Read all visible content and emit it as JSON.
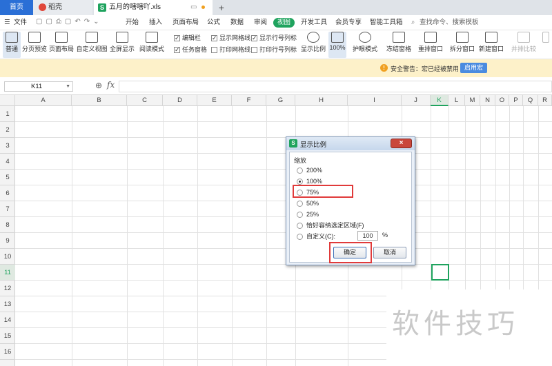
{
  "tabs": {
    "home": "首页",
    "daoke": "稻壳",
    "doc": "五月的嗐嗐吖.xls",
    "new_tab": "+"
  },
  "menu": {
    "file": "文件",
    "items": [
      "开始",
      "插入",
      "页面布局",
      "公式",
      "数据",
      "审阅",
      "视图",
      "开发工具",
      "会员专享",
      "智能工具箱"
    ],
    "search": "查找命令、搜索模板"
  },
  "ribbon": {
    "buttons": [
      "普通",
      "分页预览",
      "页面布局",
      "自定义视图",
      "全屏显示",
      "阅读模式",
      "显示比例",
      "100%",
      "护眼模式",
      "冻结窗格",
      "重排窗口",
      "拆分窗口",
      "新建窗口",
      "并排比较"
    ],
    "checks": [
      {
        "label": "编辑栏",
        "checked": true
      },
      {
        "label": "显示网格线",
        "checked": true
      },
      {
        "label": "显示行号列标",
        "checked": true
      },
      {
        "label": "任务窗格",
        "checked": true
      },
      {
        "label": "打印网格线",
        "checked": false
      },
      {
        "label": "打印行号列标",
        "checked": false
      }
    ]
  },
  "security": {
    "text": "安全警告：宏已经被禁用",
    "button": "启用宏"
  },
  "formula_bar": {
    "cell_ref": "K11",
    "fx": "fx"
  },
  "columns": [
    "A",
    "B",
    "C",
    "D",
    "E",
    "F",
    "G",
    "H",
    "I",
    "J",
    "K",
    "L",
    "M",
    "N",
    "O",
    "P",
    "Q",
    "R"
  ],
  "rows": [
    "1",
    "2",
    "3",
    "4",
    "5",
    "6",
    "7",
    "8",
    "9",
    "10",
    "11",
    "12",
    "13",
    "14",
    "15",
    "16"
  ],
  "active": {
    "column": "K",
    "row": "11"
  },
  "dialog": {
    "title": "显示比例",
    "group": "缩放",
    "options": [
      {
        "label": "200%",
        "selected": false
      },
      {
        "label": "100%",
        "selected": true
      },
      {
        "label": "75%",
        "selected": false
      },
      {
        "label": "50%",
        "selected": false
      },
      {
        "label": "25%",
        "selected": false
      },
      {
        "label": "恰好容纳选定区域(F)",
        "selected": false
      },
      {
        "label": "自定义(C):",
        "selected": false
      }
    ],
    "custom_value": "100",
    "percent": "%",
    "ok": "确定",
    "cancel": "取消",
    "close": "×"
  },
  "watermark": "软件技巧",
  "colors": {
    "accent": "#1fa35e",
    "tab_active": "#2a6fd6",
    "highlight": "#e03a3a"
  }
}
